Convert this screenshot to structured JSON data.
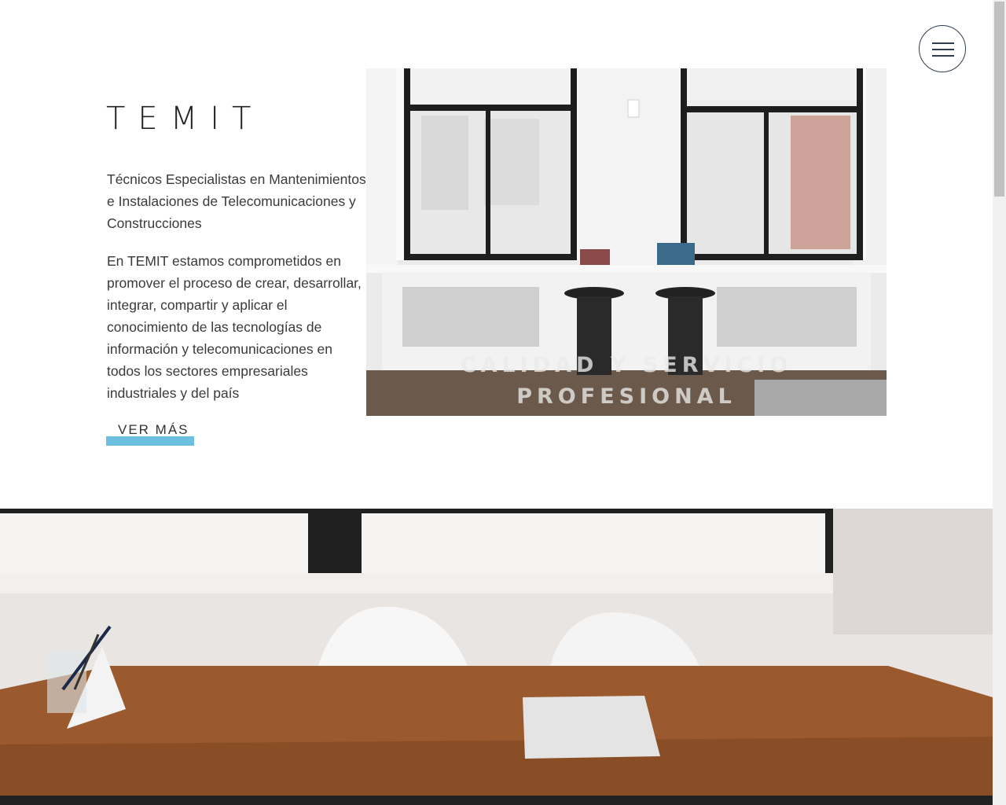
{
  "header": {
    "menu_icon": "hamburger-icon"
  },
  "hero": {
    "brand": "TEMIT",
    "tagline": "Técnicos Especialistas en Mantenimientos e Instalaciones de Telecomunicaciones y Construcciones",
    "description": "En TEMIT estamos comprometidos en promover el proceso de crear, desarrollar, integrar, compartir y aplicar el conocimiento de las tecnologías de información y telecomunicaciones en todos los sectores empresariales industriales y del país",
    "cta_label": "VER MÁS",
    "image_caption_line1": "CALIDAD Y SERVICIO",
    "image_caption_line2": "PROFESIONAL"
  },
  "colors": {
    "accent": "#6bbfdf",
    "text": "#333333",
    "menu_border": "#2f3e4e"
  }
}
